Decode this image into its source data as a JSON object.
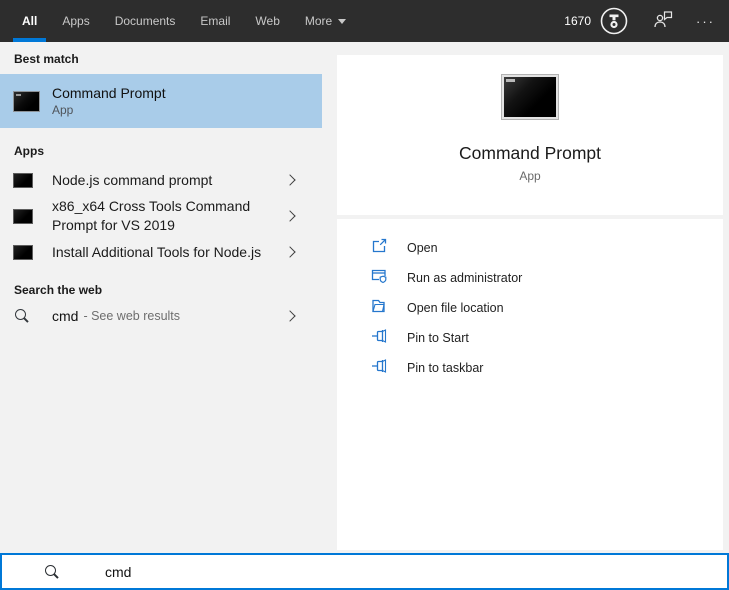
{
  "topbar": {
    "tabs": [
      {
        "label": "All",
        "active": true
      },
      {
        "label": "Apps",
        "active": false
      },
      {
        "label": "Documents",
        "active": false
      },
      {
        "label": "Email",
        "active": false
      },
      {
        "label": "Web",
        "active": false
      },
      {
        "label": "More",
        "active": false,
        "has_dropdown": true
      }
    ],
    "rewards_points": "1670",
    "ellipsis_glyph": "···"
  },
  "left": {
    "best_match_header": "Best match",
    "best_match": {
      "title": "Command Prompt",
      "subtitle": "App"
    },
    "apps_header": "Apps",
    "apps": [
      {
        "title": "Node.js command prompt"
      },
      {
        "title": "x86_x64 Cross Tools Command Prompt for VS 2019"
      },
      {
        "title": "Install Additional Tools for Node.js"
      }
    ],
    "web_header": "Search the web",
    "web": {
      "query": "cmd",
      "suffix": "- See web results"
    }
  },
  "preview": {
    "title": "Command Prompt",
    "subtitle": "App",
    "actions": [
      {
        "label": "Open",
        "icon": "open-icon"
      },
      {
        "label": "Run as administrator",
        "icon": "admin-shield-icon"
      },
      {
        "label": "Open file location",
        "icon": "folder-icon"
      },
      {
        "label": "Pin to Start",
        "icon": "pin-icon"
      },
      {
        "label": "Pin to taskbar",
        "icon": "pin-icon"
      }
    ]
  },
  "search": {
    "value": "cmd"
  },
  "colors": {
    "accent": "#0078d7",
    "topbar_bg": "#2d2d2d",
    "highlight": "#a9cce9",
    "panel_bg": "#f2f2f2"
  }
}
